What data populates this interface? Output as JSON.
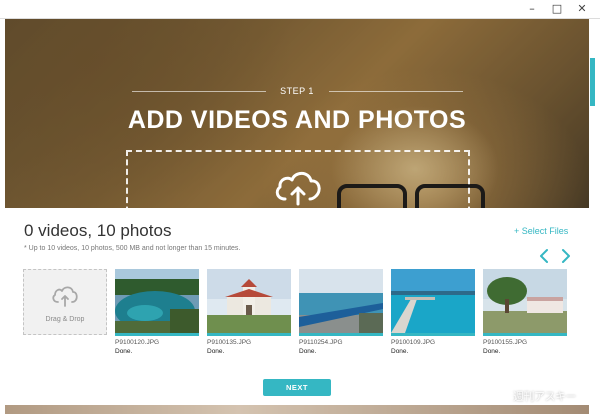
{
  "window": {
    "minimize_glyph": "–",
    "maximize_glyph": "□",
    "close_glyph": "✕"
  },
  "hero": {
    "step": "STEP 1",
    "title": "ADD VIDEOS AND PHOTOS",
    "upload_icon": "cloud-upload-icon"
  },
  "media": {
    "count": "0 videos, 10 photos",
    "select_files": "+ Select Files",
    "note": "* Up to 10 videos, 10 photos, 500 MB and not longer than 15 minutes.",
    "drag_drop": "Drag & Drop",
    "thumbnails": [
      {
        "name": "P9100120.JPG",
        "status": "Done."
      },
      {
        "name": "P9100135.JPG",
        "status": "Done."
      },
      {
        "name": "P9110254.JPG",
        "status": "Done."
      },
      {
        "name": "P9100109.JPG",
        "status": "Done."
      },
      {
        "name": "P9100155.JPG",
        "status": "Done."
      }
    ]
  },
  "actions": {
    "next": "NEXT"
  },
  "watermark": "週刊アスキー",
  "colors": {
    "accent": "#35b7c3"
  }
}
